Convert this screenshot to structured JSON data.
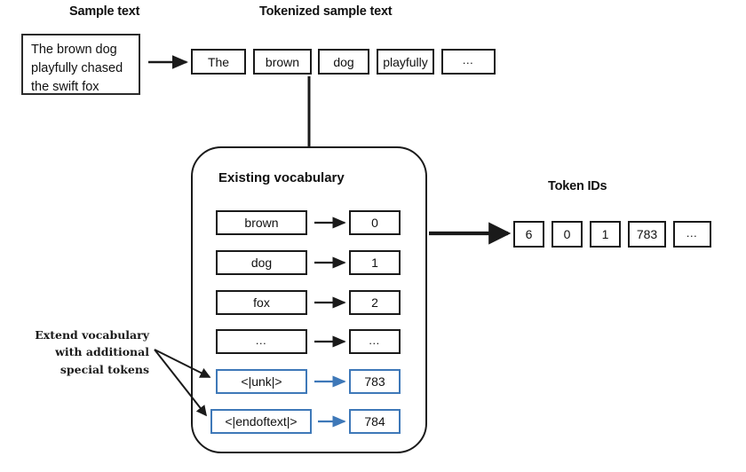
{
  "diagram": {
    "title_sample": "Sample text",
    "title_tokenized": "Tokenized sample text",
    "title_token_ids": "Token IDs",
    "accent_blue": "#3e78b8",
    "ink": "#1a1a1a"
  },
  "sample_text": {
    "line1": "The brown dog",
    "line2": "playfully chased",
    "line3": "the swift fox"
  },
  "tokens": [
    {
      "label": "The"
    },
    {
      "label": "brown"
    },
    {
      "label": "dog"
    },
    {
      "label": "playfully"
    },
    {
      "label": "…"
    }
  ],
  "vocabulary": {
    "title": "Existing vocabulary",
    "rows": [
      {
        "token": "brown",
        "id": "0",
        "special": false
      },
      {
        "token": "dog",
        "id": "1",
        "special": false
      },
      {
        "token": "fox",
        "id": "2",
        "special": false
      },
      {
        "token": "…",
        "id": "…",
        "special": false
      },
      {
        "token": "<|unk|>",
        "id": "783",
        "special": true
      },
      {
        "token": "<|endoftext|>",
        "id": "784",
        "special": true
      }
    ]
  },
  "annotation": {
    "line1": "Extend vocabulary",
    "line2": "with additional",
    "line3": "special tokens"
  },
  "token_ids": [
    {
      "value": "6"
    },
    {
      "value": "0"
    },
    {
      "value": "1"
    },
    {
      "value": "783"
    },
    {
      "value": "…"
    }
  ]
}
